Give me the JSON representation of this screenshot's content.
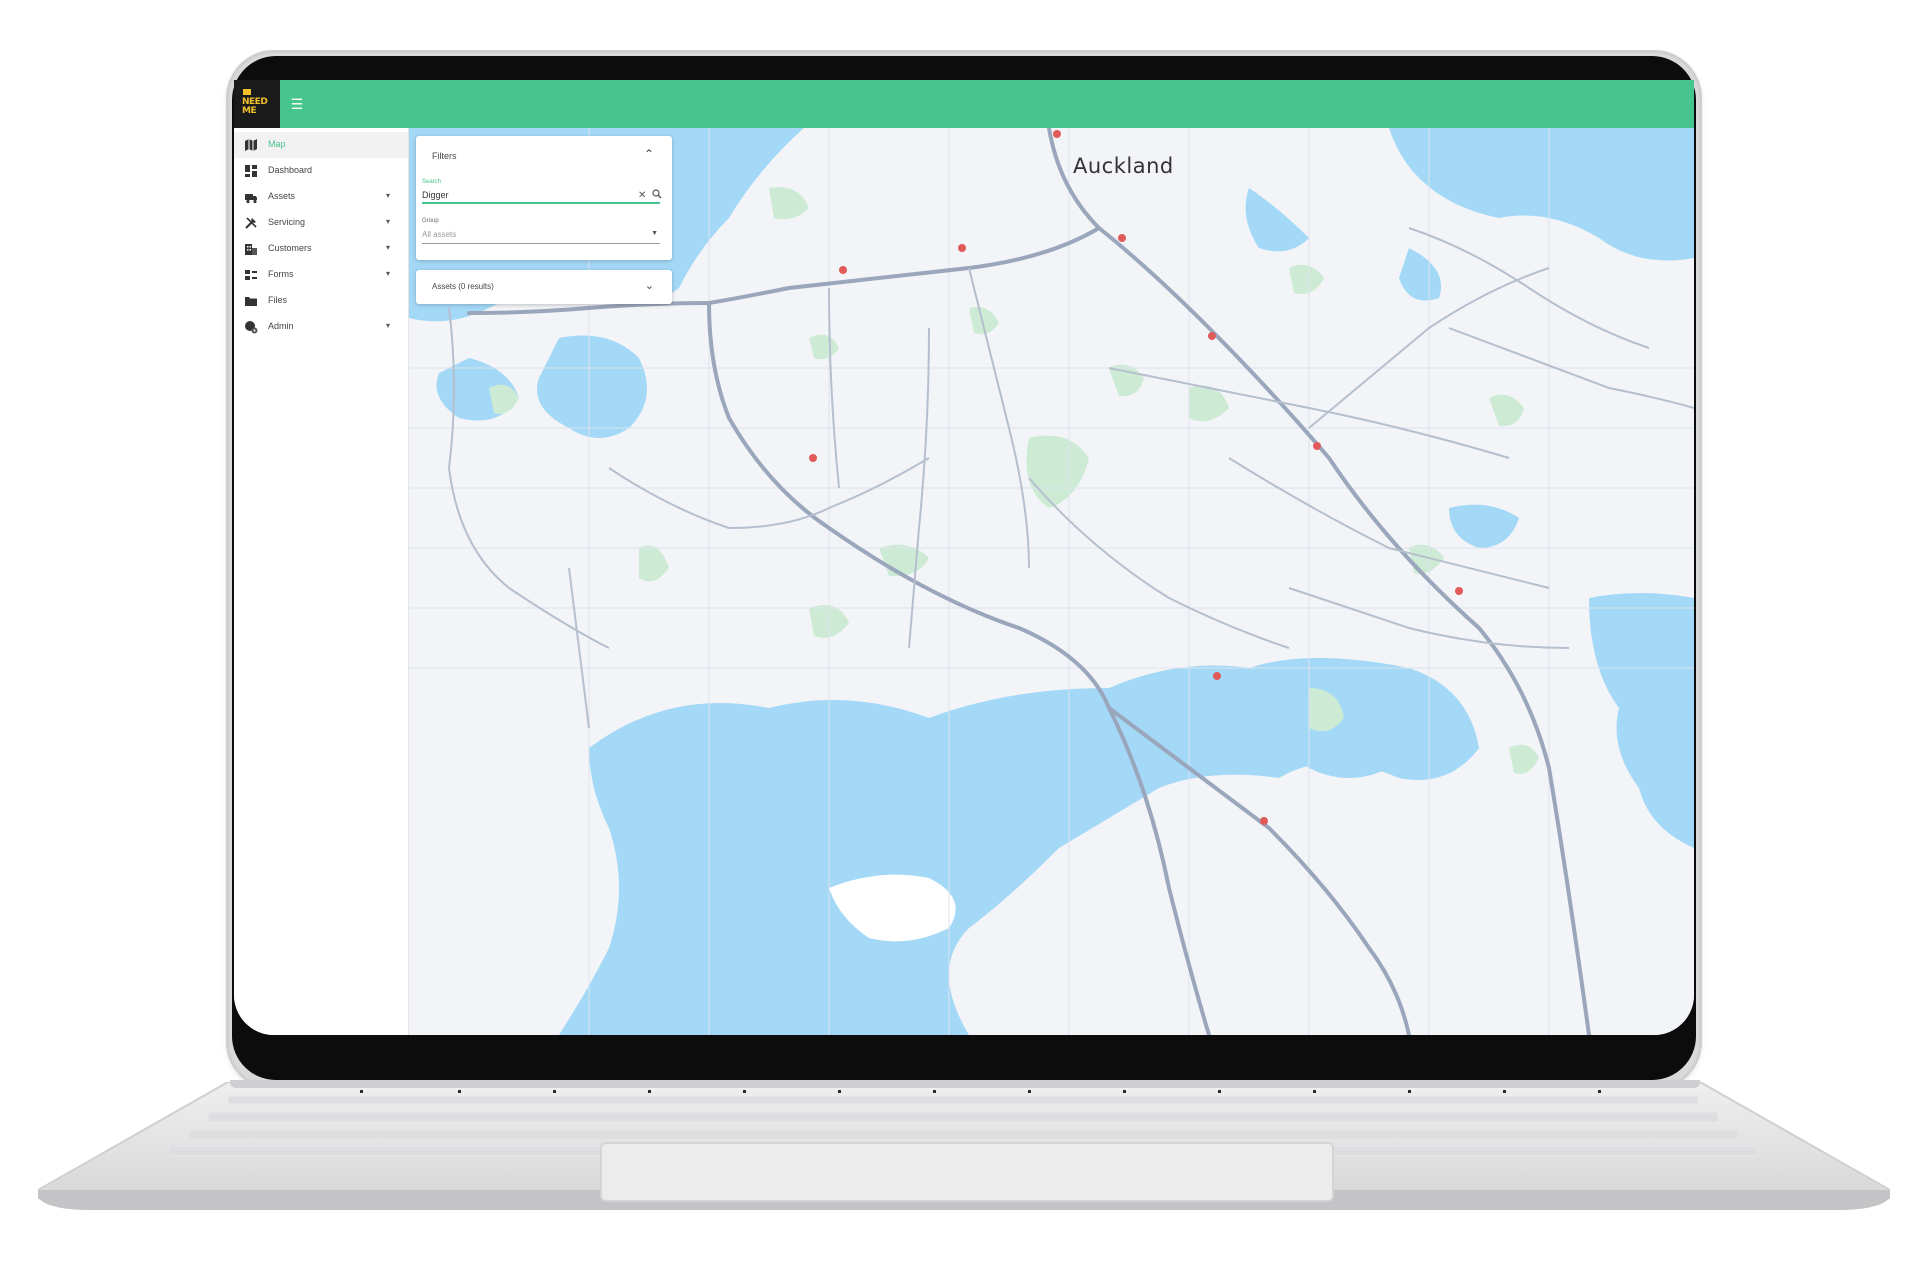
{
  "app": {
    "logo_line1": "NEED",
    "logo_line2": "ME",
    "menu_icon": "menu-icon",
    "accent_color": "#47c58e"
  },
  "sidebar": {
    "items": [
      {
        "label": "Map",
        "icon": "map-icon",
        "active": true,
        "expandable": false
      },
      {
        "label": "Dashboard",
        "icon": "dashboard-icon",
        "active": false,
        "expandable": false
      },
      {
        "label": "Assets",
        "icon": "truck-icon",
        "active": false,
        "expandable": true
      },
      {
        "label": "Servicing",
        "icon": "tools-icon",
        "active": false,
        "expandable": true
      },
      {
        "label": "Customers",
        "icon": "building-icon",
        "active": false,
        "expandable": true
      },
      {
        "label": "Forms",
        "icon": "forms-icon",
        "active": false,
        "expandable": true
      },
      {
        "label": "Files",
        "icon": "folder-icon",
        "active": false,
        "expandable": false
      },
      {
        "label": "Admin",
        "icon": "admin-icon",
        "active": false,
        "expandable": true
      }
    ]
  },
  "filters": {
    "title": "Filters",
    "search_label": "Search",
    "search_value": "Digger",
    "group_label": "Group",
    "group_value": "All assets"
  },
  "assets_panel": {
    "label": "Assets (0 results)"
  },
  "map": {
    "city_label": "Auckland",
    "water_color": "#a4d8f7",
    "land_color": "#f2f4f7",
    "park_color": "#cdebd4",
    "road_color": "#9aa6bb"
  }
}
